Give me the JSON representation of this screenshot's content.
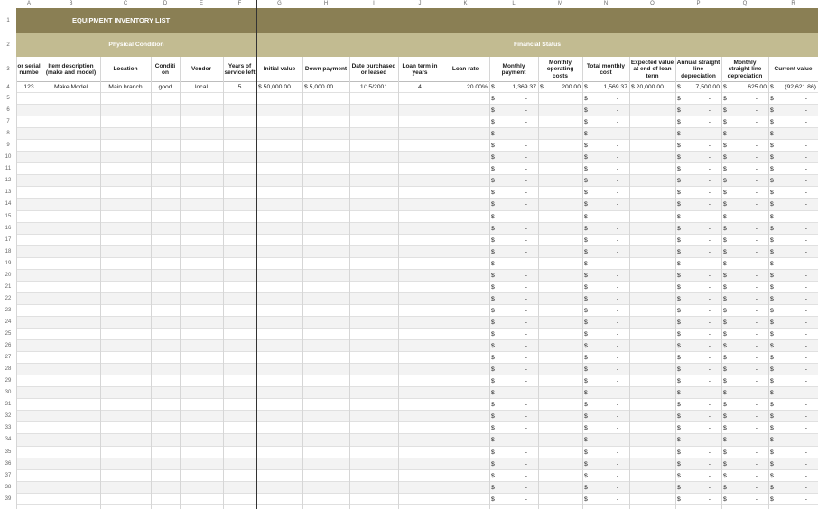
{
  "columns": [
    "A",
    "B",
    "C",
    "D",
    "E",
    "F",
    "G",
    "H",
    "I",
    "J",
    "K",
    "L",
    "M",
    "N",
    "O",
    "P",
    "Q",
    "R"
  ],
  "title": "EQUIPMENT INVENTORY LIST",
  "sections": {
    "physical": "Physical Condition",
    "financial": "Financial Status"
  },
  "headers": [
    "or serial numbe",
    "Item description (make and model)",
    "Location",
    "Conditi on",
    "Vendor",
    "Years of service left",
    "Initial value",
    "Down payment",
    "Date purchased or leased",
    "Loan term in years",
    "Loan rate",
    "Monthly payment",
    "Monthly operating costs",
    "Total monthly cost",
    "Expected value at end of loan term",
    "Annual straight line depreciation",
    "Monthly straight line depreciation",
    "Current value"
  ],
  "row_numbers": [
    1,
    2,
    3,
    4,
    5,
    6,
    7,
    8,
    9,
    10,
    11,
    12,
    13,
    14,
    15,
    16,
    17,
    18,
    19,
    20,
    21,
    22,
    23,
    24,
    25,
    26,
    27,
    28,
    29,
    30,
    31,
    32,
    33,
    34,
    35,
    36,
    37,
    38,
    39
  ],
  "first_row": {
    "A": "123",
    "B": "Make Model",
    "C": "Main branch",
    "D": "good",
    "E": "local",
    "F": "5",
    "G": "$ 50,000.00",
    "H": "$ 5,000.00",
    "I": "1/15/2001",
    "J": "4",
    "K": "20.00%",
    "L": "1,369.37",
    "M": "200.00",
    "N": "1,569.37",
    "O": "$ 20,000.00",
    "P": "7,500.00",
    "Q": "625.00",
    "R": "(92,621.86)"
  },
  "currency_symbol": "$",
  "empty_value": "-",
  "colors": {
    "title_band": "#8a7f54",
    "section_band": "#c2bb91",
    "header_bg": "#ffffff",
    "row_alt": "#f3f3f3",
    "freeze_line": "#333333"
  }
}
